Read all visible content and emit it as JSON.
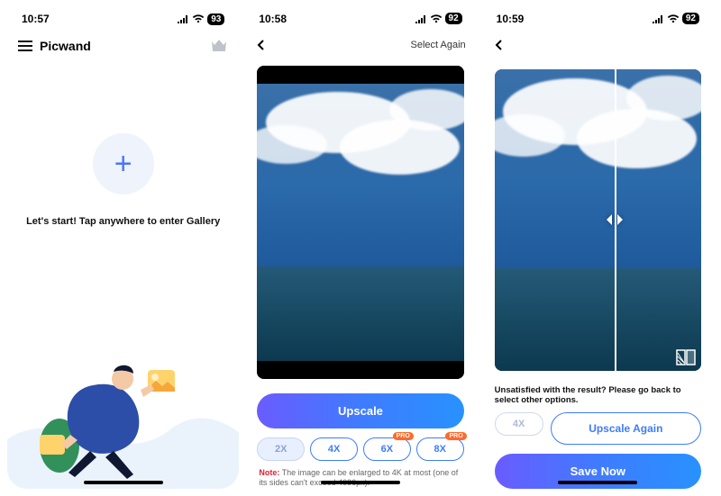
{
  "screen1": {
    "status": {
      "time": "10:57",
      "battery": "93"
    },
    "app_name": "Picwand",
    "prompt": "Let's start! Tap anywhere to enter Gallery",
    "plus_icon": "plus-icon",
    "crown_icon": "crown-icon",
    "menu_icon": "menu-icon"
  },
  "screen2": {
    "status": {
      "time": "10:58",
      "battery": "92"
    },
    "back_icon": "chevron-left-icon",
    "select_again": "Select Again",
    "upscale_label": "Upscale",
    "scales": [
      {
        "label": "2X",
        "active": true,
        "pro": false
      },
      {
        "label": "4X",
        "active": false,
        "pro": false
      },
      {
        "label": "6X",
        "active": false,
        "pro": true
      },
      {
        "label": "8X",
        "active": false,
        "pro": true
      }
    ],
    "pro_badge": "PRO",
    "note_prefix": "Note:",
    "note_text": " The image can be enlarged to 4K at most (one of its sides can't exceed 4096px)."
  },
  "screen3": {
    "status": {
      "time": "10:59",
      "battery": "92"
    },
    "back_icon": "chevron-left-icon",
    "message": "Unsatisfied with the result? Please go back to select other options.",
    "disabled_scale": "4X",
    "upscale_again": "Upscale Again",
    "save_now": "Save Now",
    "compare_icon": "compare-handle-icon",
    "toggle_icon": "compare-toggle-icon"
  }
}
